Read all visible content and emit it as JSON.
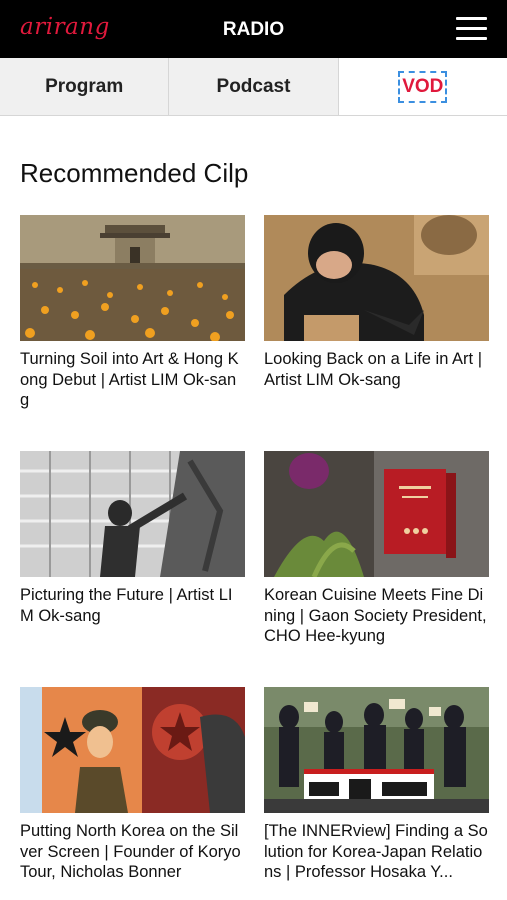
{
  "header": {
    "logo": "arirang",
    "title": "RADIO",
    "menu_icon": "hamburger-menu-icon"
  },
  "tabs": [
    {
      "label": "Program",
      "active": false
    },
    {
      "label": "Podcast",
      "active": false
    },
    {
      "label": "VOD",
      "active": true
    }
  ],
  "section": {
    "title": "Recommended Cilp"
  },
  "clips": [
    {
      "title": "Turning Soil into Art & Hong Kong Debut | Artist LIM Ok-sang"
    },
    {
      "title": "Looking Back on a Life in Art | Artist LIM Ok-sang"
    },
    {
      "title": "Picturing the Future | Artist LIM Ok-sang"
    },
    {
      "title": "Korean Cuisine Meets Fine Dining | Gaon Society President, CHO Hee-kyung"
    },
    {
      "title": "Putting North Korea on the Silver Screen | Founder of Koryo Tour, Nicholas Bonner"
    },
    {
      "title": "[The INNERview] Finding a Solution for Korea-Japan Relations | Professor Hosaka Y..."
    }
  ],
  "colors": {
    "brand": "#e0193c",
    "header_bg": "#000000",
    "tab_inactive_bg": "#f0f0f0"
  }
}
